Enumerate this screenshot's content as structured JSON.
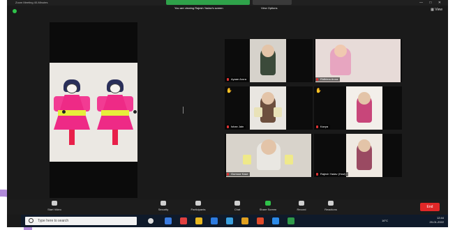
{
  "window": {
    "title": "Zoom Meeting 40-Minutes",
    "share_banner": "You are viewing Rajesh Yadav's screen",
    "view_options_label": "View Options",
    "view_label": "View"
  },
  "participants": [
    {
      "name": "Ayaan Arora",
      "raised_hand": false
    },
    {
      "name": "Ridhima Arora",
      "raised_hand": false
    },
    {
      "name": "Ishan Jain",
      "raised_hand": true
    },
    {
      "name": "Kavya",
      "raised_hand": true
    },
    {
      "name": "Gurnoor Kaur",
      "raised_hand": false
    },
    {
      "name": "Rajesh Yadav (Host)",
      "raised_hand": false
    }
  ],
  "toolbar": {
    "items": [
      {
        "label": "Start Video",
        "icon": "video-camera-icon"
      },
      {
        "label": "Security",
        "icon": "shield-icon"
      },
      {
        "label": "Participants",
        "icon": "people-icon",
        "count": "27"
      },
      {
        "label": "Chat",
        "icon": "chat-icon"
      },
      {
        "label": "Share Screen",
        "icon": "share-screen-icon"
      },
      {
        "label": "Record",
        "icon": "record-icon"
      },
      {
        "label": "Reactions",
        "icon": "smiley-icon"
      }
    ],
    "end_label": "End"
  },
  "taskbar": {
    "search_placeholder": "Type here to search",
    "temperature": "16°C",
    "time": "12:44",
    "date": "20-01-2022"
  },
  "colors": {
    "share_green": "#2fa24a",
    "end_red": "#e02828",
    "dress_pink": "#ee2a86",
    "belt_yellow": "#e7ee3a"
  }
}
